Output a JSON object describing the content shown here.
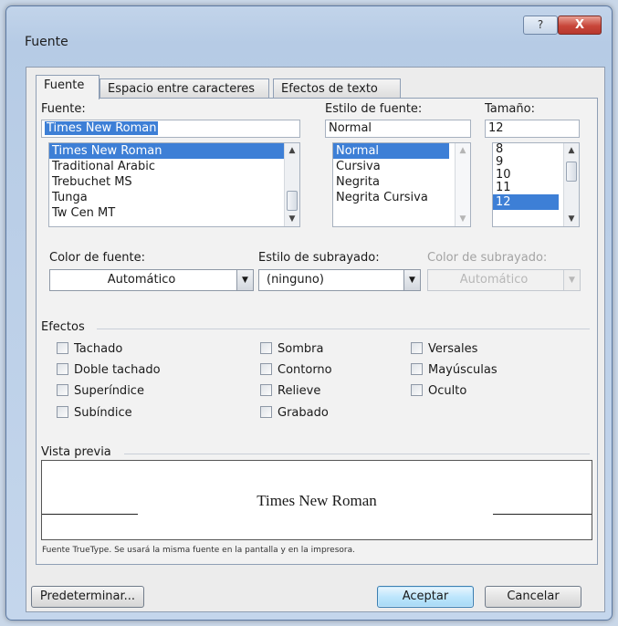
{
  "window": {
    "title": "Fuente",
    "help_glyph": "?",
    "close_glyph": "X"
  },
  "tabs": [
    {
      "label": "Fuente",
      "active": true
    },
    {
      "label": "Espacio entre caracteres",
      "active": false
    },
    {
      "label": "Efectos de texto",
      "active": false
    }
  ],
  "font": {
    "label": "Fuente:",
    "value": "Times New Roman",
    "items": [
      "Times New Roman",
      "Traditional Arabic",
      "Trebuchet MS",
      "Tunga",
      "Tw Cen MT"
    ],
    "selected_index": 0
  },
  "style": {
    "label": "Estilo de fuente:",
    "value": "Normal",
    "items": [
      "Normal",
      "Cursiva",
      "Negrita",
      "Negrita Cursiva"
    ],
    "selected_index": 0
  },
  "size": {
    "label": "Tamaño:",
    "value": "12",
    "items": [
      "8",
      "9",
      "10",
      "11",
      "12"
    ],
    "selected_index": 4
  },
  "font_color": {
    "label": "Color de fuente:",
    "value": "Automático"
  },
  "underline_style": {
    "label": "Estilo de subrayado:",
    "value": "(ninguno)"
  },
  "underline_color": {
    "label": "Color de subrayado:",
    "value": "Automático",
    "disabled": true
  },
  "effects": {
    "title": "Efectos",
    "items": [
      {
        "label": "Tachado",
        "checked": false
      },
      {
        "label": "Doble tachado",
        "checked": false
      },
      {
        "label": "Superíndice",
        "checked": false
      },
      {
        "label": "Subíndice",
        "checked": false
      },
      {
        "label": "Sombra",
        "checked": false
      },
      {
        "label": "Contorno",
        "checked": false
      },
      {
        "label": "Relieve",
        "checked": false
      },
      {
        "label": "Grabado",
        "checked": false
      },
      {
        "label": "Versales",
        "checked": false
      },
      {
        "label": "Mayúsculas",
        "checked": false
      },
      {
        "label": "Oculto",
        "checked": false
      }
    ]
  },
  "preview": {
    "title": "Vista previa",
    "text": "Times New Roman",
    "note": "Fuente TrueType. Se usará la misma fuente en la pantalla y en la impresora."
  },
  "buttons": {
    "default": "Predeterminar...",
    "ok": "Aceptar",
    "cancel": "Cancelar"
  },
  "colors": {
    "selection": "#3d7fd6",
    "close_button": "#c8463a",
    "window_frame": "#b6cbe5"
  }
}
